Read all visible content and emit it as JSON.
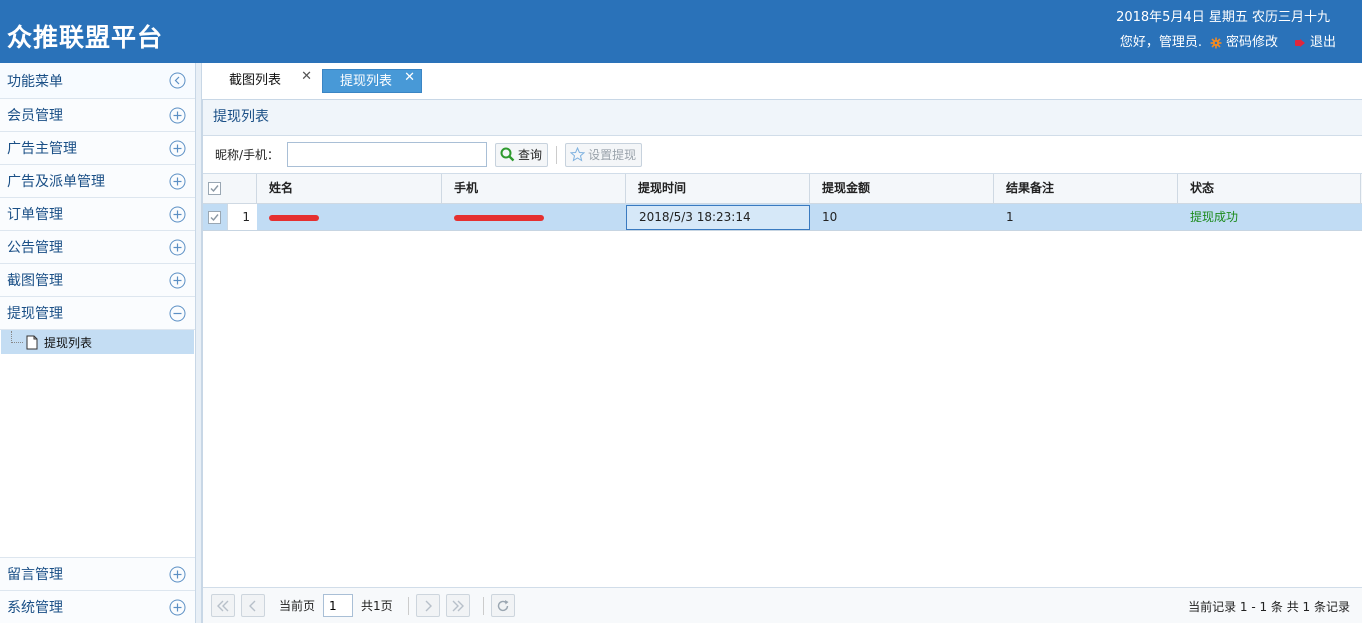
{
  "header": {
    "title": "众推联盟平台",
    "date": "2018年5月4日 星期五 农历三月十九",
    "greeting": "您好，管理员.",
    "change_password": "密码修改",
    "logout": "退出"
  },
  "sidebar": {
    "menu_title": "功能菜单",
    "groups": [
      {
        "label": "会员管理"
      },
      {
        "label": "广告主管理"
      },
      {
        "label": "广告及派单管理"
      },
      {
        "label": "订单管理"
      },
      {
        "label": "公告管理"
      },
      {
        "label": "截图管理"
      },
      {
        "label": "提现管理"
      }
    ],
    "active_subitem": "提现列表",
    "bottom_groups": [
      {
        "label": "留言管理"
      },
      {
        "label": "系统管理"
      }
    ]
  },
  "tabs": [
    {
      "label": "截图列表",
      "active": false
    },
    {
      "label": "提现列表",
      "active": true
    }
  ],
  "panel": {
    "title": "提现列表",
    "filter_label": "昵称/手机：",
    "filter_value": "",
    "search_label": "查询",
    "set_withdraw_label": "设置提现"
  },
  "grid": {
    "columns": [
      "姓名",
      "手机",
      "提现时间",
      "提现金额",
      "结果备注",
      "状态"
    ],
    "rows": [
      {
        "num": "1",
        "name": "",
        "phone": "",
        "time": "2018/5/3 18:23:14",
        "amount": "10",
        "note": "1",
        "status": "提现成功"
      }
    ]
  },
  "pager": {
    "current_label": "当前页",
    "page": "1",
    "total_label": "共1页",
    "info": "当前记录 1 - 1 条 共 1 条记录"
  },
  "colors": {
    "header_bg": "#2a72b9",
    "active_tab": "#4899d7",
    "row_selected": "#c1dcf4",
    "status_ok": "#1b8a1b"
  }
}
